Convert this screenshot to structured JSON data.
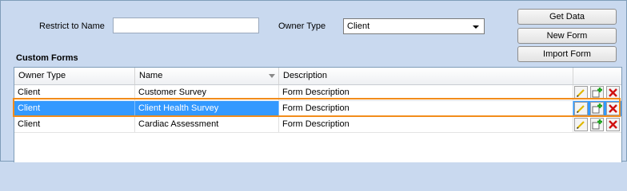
{
  "filters": {
    "restrict_label": "Restrict to Name",
    "restrict_value": "",
    "owner_label": "Owner Type",
    "owner_value": "Client"
  },
  "buttons": {
    "get_data": "Get Data",
    "new_form": "New Form",
    "import_form": "Import Form"
  },
  "section_title": "Custom Forms",
  "grid": {
    "columns": [
      "Owner Type",
      "Name",
      "Description"
    ],
    "rows": [
      {
        "owner": "Client",
        "name": "Customer Survey",
        "description": "Form Description"
      },
      {
        "owner": "Client",
        "name": "Client Health Survey",
        "description": "Form Description"
      },
      {
        "owner": "Client",
        "name": "Cardiac Assessment",
        "description": "Form Description"
      }
    ],
    "selected_row": 1
  },
  "row_actions": [
    "edit-icon",
    "add-icon",
    "delete-icon"
  ],
  "colors": {
    "background": "#c9d9ef",
    "selection": "#3399ff",
    "focus_border": "#f28c1a"
  }
}
